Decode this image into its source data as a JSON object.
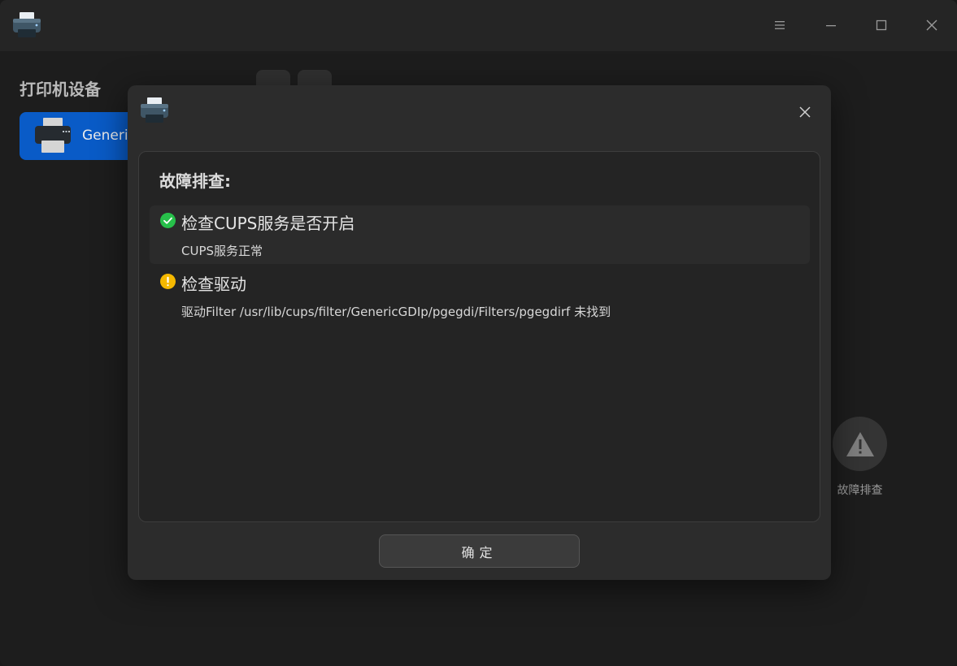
{
  "sidebar": {
    "title": "打印机设备",
    "printers": [
      {
        "name": "Generic"
      }
    ]
  },
  "right_panel": {
    "troubleshoot_label": "故障排查"
  },
  "dialog": {
    "heading": "故障排查:",
    "checks": [
      {
        "status": "success",
        "status_color": "#27c04a",
        "title": "检查CUPS服务是否开启",
        "detail": "CUPS服务正常"
      },
      {
        "status": "warning",
        "status_color": "#f5b800",
        "title": "检查驱动",
        "detail": "驱动Filter /usr/lib/cups/filter/GenericGDIp/pgegdi/Filters/pgegdirf 未找到"
      }
    ],
    "ok_label": "确定"
  },
  "colors": {
    "accent": "#0a63d8",
    "success": "#27c04a",
    "warning": "#f5b800"
  }
}
